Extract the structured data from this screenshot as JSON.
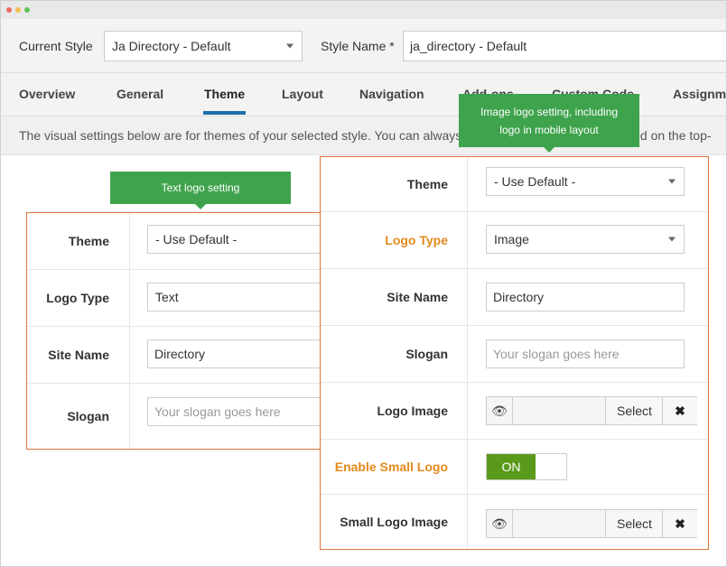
{
  "toolbar": {
    "current_style_label": "Current Style",
    "current_style_value": "Ja Directory - Default",
    "style_name_label": "Style Name *",
    "style_name_value": "ja_directory - Default"
  },
  "tabs": [
    {
      "label": "Overview"
    },
    {
      "label": "General"
    },
    {
      "label": "Theme",
      "active": true
    },
    {
      "label": "Layout"
    },
    {
      "label": "Navigation"
    },
    {
      "label": "Add-ons"
    },
    {
      "label": "Custom Code"
    },
    {
      "label": "Assignment"
    }
  ],
  "description": "The visual settings below are for themes of your selected style. You can always switch themes which are located on the top-",
  "tooltips": {
    "text_logo": "Text logo setting",
    "image_logo_line1": "Image logo setting, including",
    "image_logo_line2": "logo in mobile layout"
  },
  "text_panel": {
    "rows": [
      {
        "label": "Theme",
        "value": "- Use Default -"
      },
      {
        "label": "Logo Type",
        "value": "Text"
      },
      {
        "label": "Site Name",
        "value": "Directory"
      },
      {
        "label": "Slogan",
        "placeholder": "Your slogan goes here"
      }
    ]
  },
  "image_panel": {
    "rows": [
      {
        "label": "Theme",
        "value": "- Use Default -"
      },
      {
        "label": "Logo Type",
        "value": "Image"
      },
      {
        "label": "Site Name",
        "value": "Directory"
      },
      {
        "label": "Slogan",
        "placeholder": "Your slogan goes here"
      },
      {
        "label": "Logo Image",
        "select_label": "Select",
        "clear_label": "✖"
      },
      {
        "label": "Enable Small Logo",
        "toggle_label": "ON"
      },
      {
        "label": "Small Logo Image",
        "select_label": "Select",
        "clear_label": "✖"
      }
    ]
  },
  "colors": {
    "panel_border": "#d9753a",
    "tooltip": "#3fa34d",
    "highlight_label": "#e38a1b",
    "toggle_on": "#5a9a1a",
    "tab_underline": "#1a6fa8"
  }
}
